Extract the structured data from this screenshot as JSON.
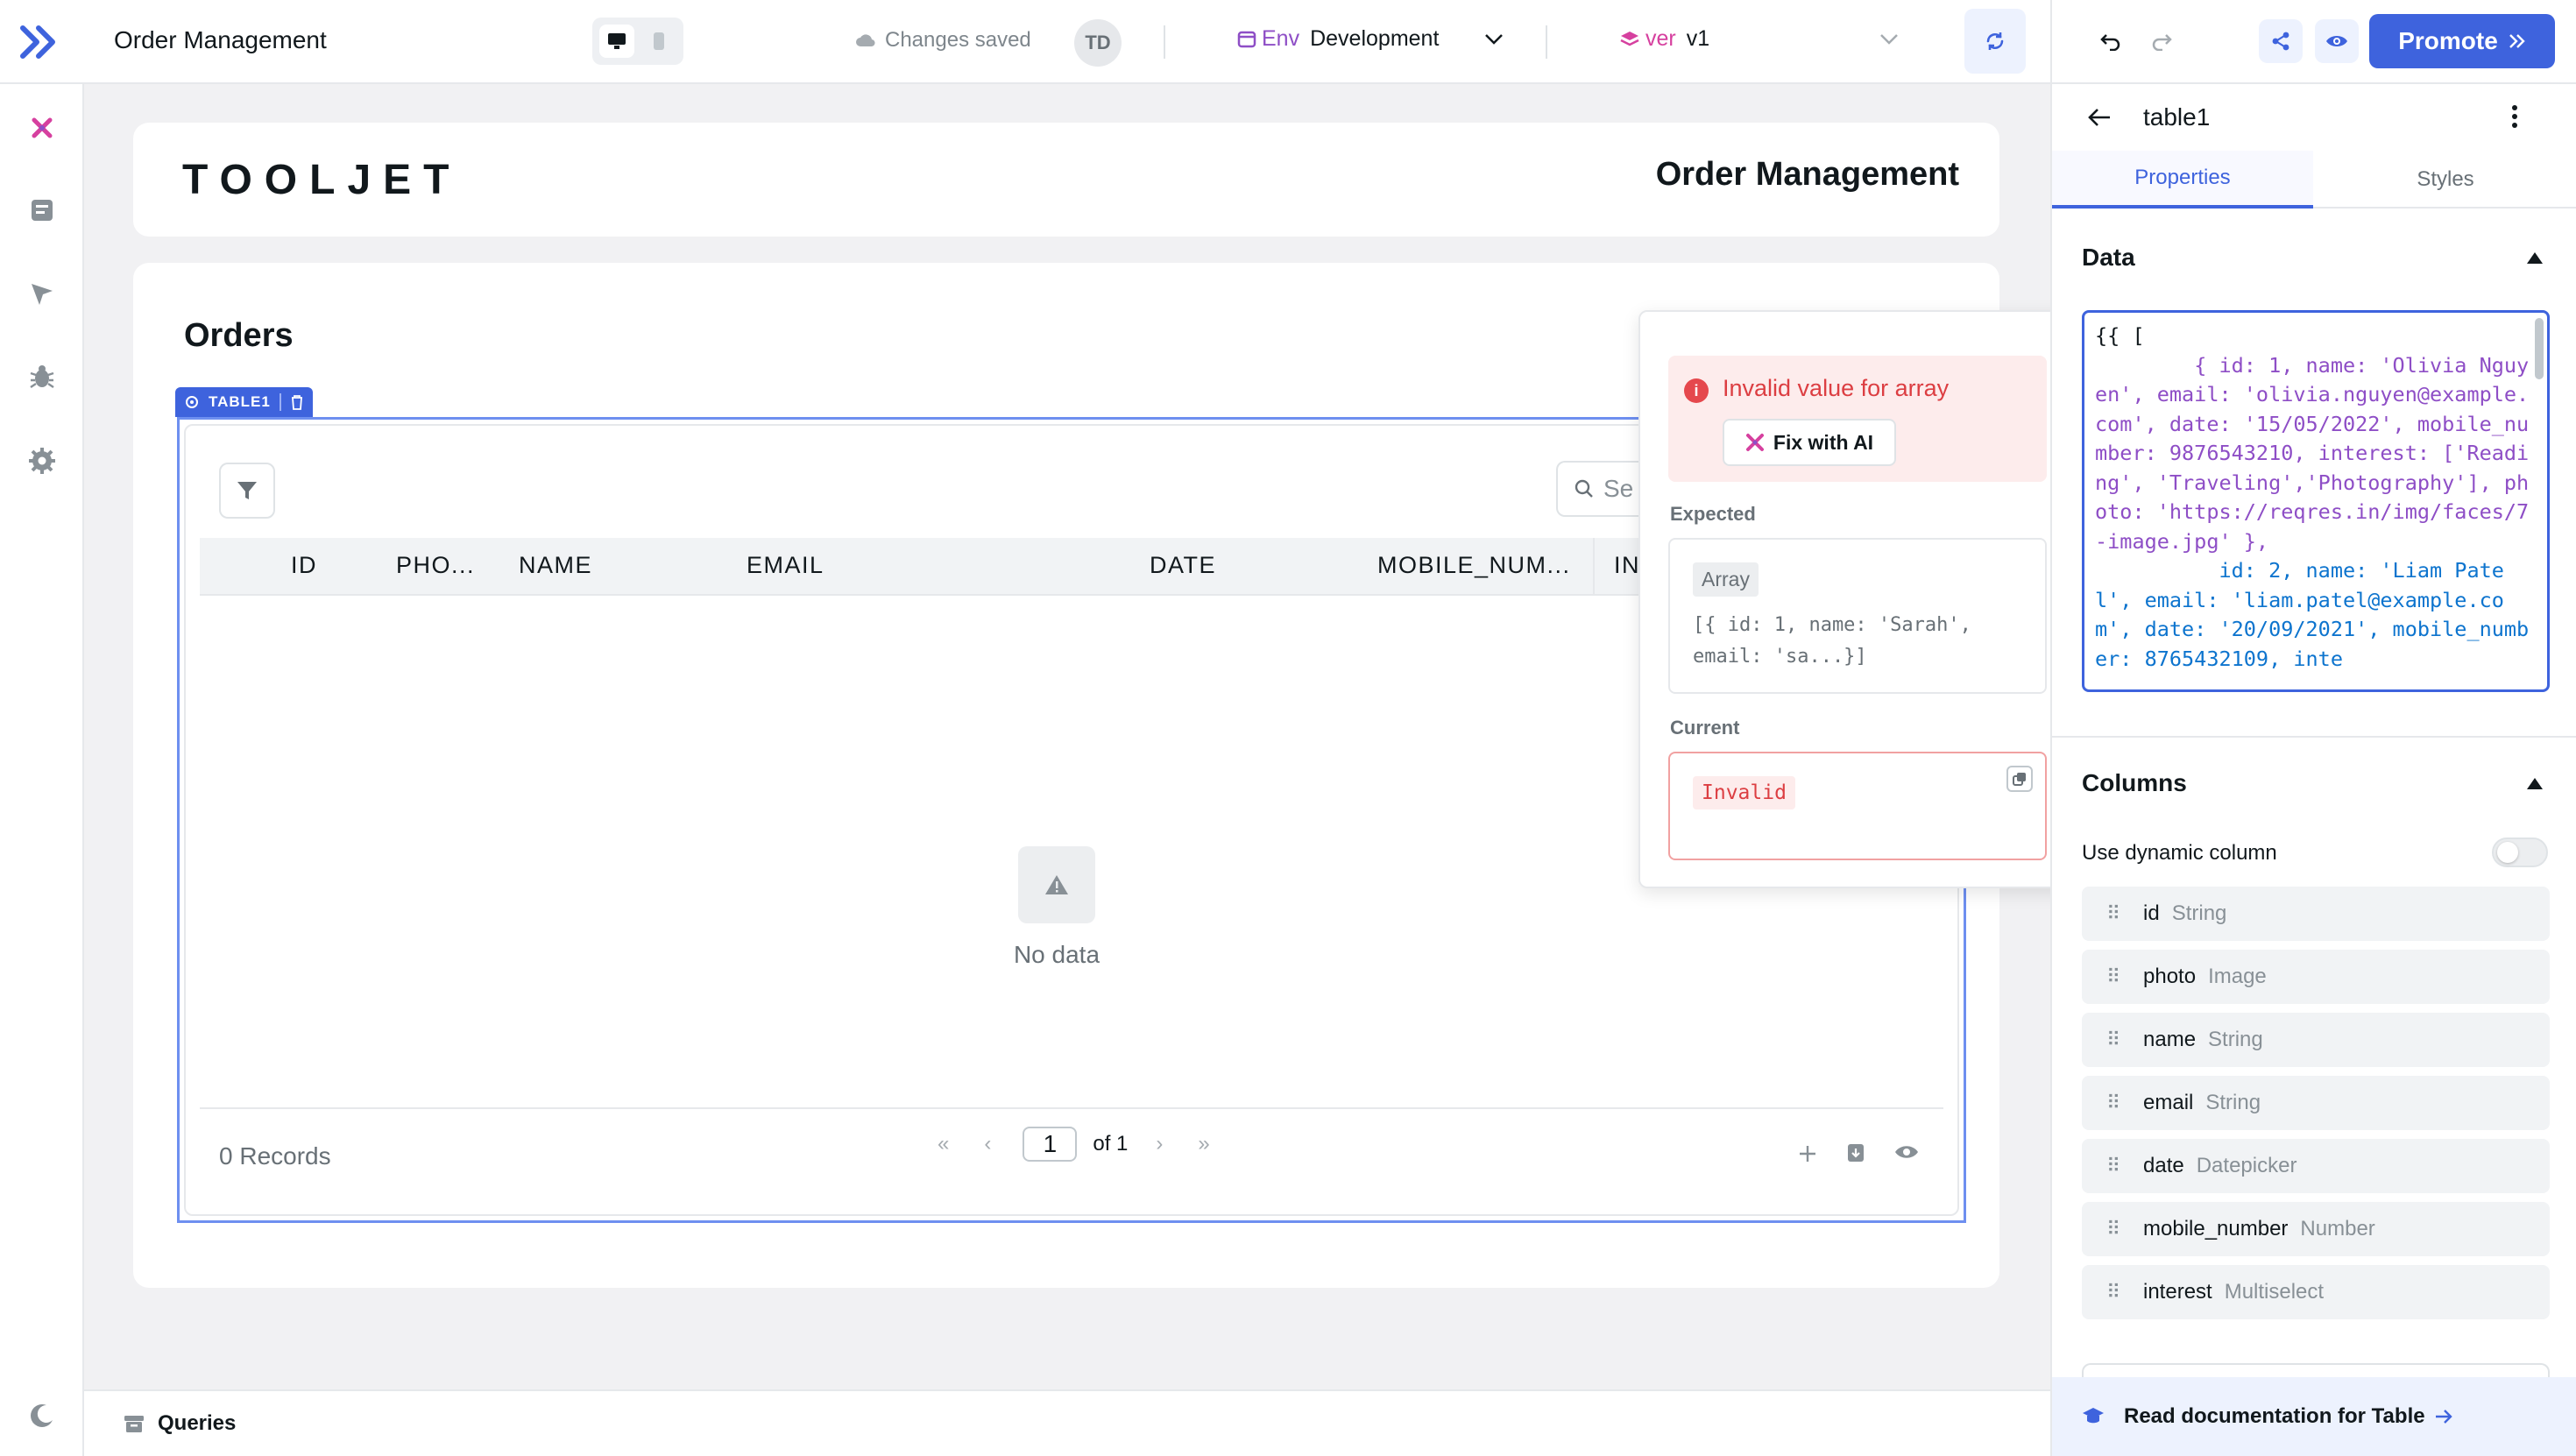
{
  "topbar": {
    "app_title": "Order Management",
    "saved_status": "Changes saved",
    "avatar_initials": "TD",
    "env_tag": "Env",
    "env_value": "Development",
    "ver_tag": "ver",
    "ver_value": "v1",
    "promote_label": "Promote"
  },
  "sidebar": {
    "icons": [
      "tooljet-ai-icon",
      "pages-icon",
      "inspector-icon",
      "debugger-icon",
      "settings-icon",
      "theme-moon-icon"
    ]
  },
  "header_card": {
    "brand": "TOOLJET",
    "title": "Order Management"
  },
  "orders_card": {
    "title": "Orders",
    "widget_tag": "TABLE1",
    "search_placeholder": "Se",
    "columns": [
      "ID",
      "PHO...",
      "NAME",
      "EMAIL",
      "DATE",
      "MOBILE_NUM...",
      "IN"
    ],
    "empty_text": "No data",
    "records": "0 Records",
    "page_current": "1",
    "page_of": "of 1"
  },
  "popover": {
    "error_title": "Invalid value for array",
    "fix_label": "Fix with AI",
    "expected_label": "Expected",
    "expected_type": "Array",
    "expected_value": "[{ id: 1, name: 'Sarah', email: 'sa...}]",
    "current_label": "Current",
    "current_value": "Invalid"
  },
  "inspector": {
    "component_name": "table1",
    "tabs": [
      "Properties",
      "Styles"
    ],
    "data_section": "Data",
    "columns_section": "Columns",
    "dynamic_column_label": "Use dynamic column",
    "dynamic_column_on": false,
    "columns": [
      {
        "name": "id",
        "type": "String"
      },
      {
        "name": "photo",
        "type": "Image"
      },
      {
        "name": "name",
        "type": "String"
      },
      {
        "name": "email",
        "type": "String"
      },
      {
        "name": "date",
        "type": "Datepicker"
      },
      {
        "name": "mobile_number",
        "type": "Number"
      },
      {
        "name": "interest",
        "type": "Multiselect"
      }
    ],
    "doc_link": "Read documentation for Table",
    "code_lines": [
      "{{ [",
      "        { id: 1, name: 'Olivia Nguyen', email: 'olivia.nguyen@example.com', date: '15/05/2022', mobile_number: 9876543210, interest: ['Reading', 'Traveling','Photography'], photo: 'https://reqres.in/img/faces/7-image.jpg' },",
      "          id: 2, name: 'Liam Patel', email: 'liam.patel@example.com', date: '20/09/2021', mobile_number: 8765432109, inte"
    ]
  },
  "queries": {
    "label": "Queries"
  },
  "colors": {
    "accent": "#3e63dd",
    "error": "#dc3e42",
    "env": "#8e4ec6",
    "ver": "#d6409f"
  }
}
